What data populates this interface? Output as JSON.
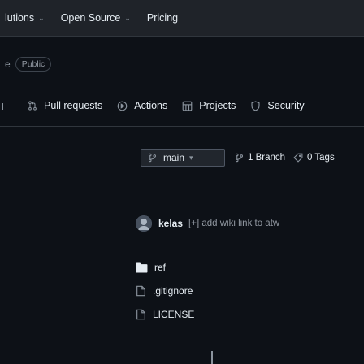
{
  "top_nav": {
    "items": [
      {
        "label": "lutions",
        "chevron": "⌄"
      },
      {
        "label": "Open Source",
        "chevron": "⌄"
      },
      {
        "label": "Pricing"
      }
    ]
  },
  "repo": {
    "name_fragment": "e",
    "visibility": "Public"
  },
  "tabs": [
    {
      "label": "Pull requests",
      "icon": "pull-request-icon"
    },
    {
      "label": "Actions",
      "icon": "play-icon"
    },
    {
      "label": "Projects",
      "icon": "table-icon"
    },
    {
      "label": "Security",
      "icon": "shield-icon"
    }
  ],
  "branch": {
    "current": "main",
    "branch_count": "1 Branch",
    "tag_count": "0 Tags"
  },
  "commit": {
    "author": "kelas",
    "message": "[+] add wiki link to atw"
  },
  "files": [
    {
      "name": "ref",
      "type": "folder"
    },
    {
      "name": ".gitignore",
      "type": "file"
    },
    {
      "name": "LICENSE",
      "type": "file"
    }
  ],
  "colors": {
    "background": "#0d1117",
    "header": "#1f2329",
    "border": "#30363d",
    "muted": "#8b949e",
    "text": "#e6edf3"
  }
}
